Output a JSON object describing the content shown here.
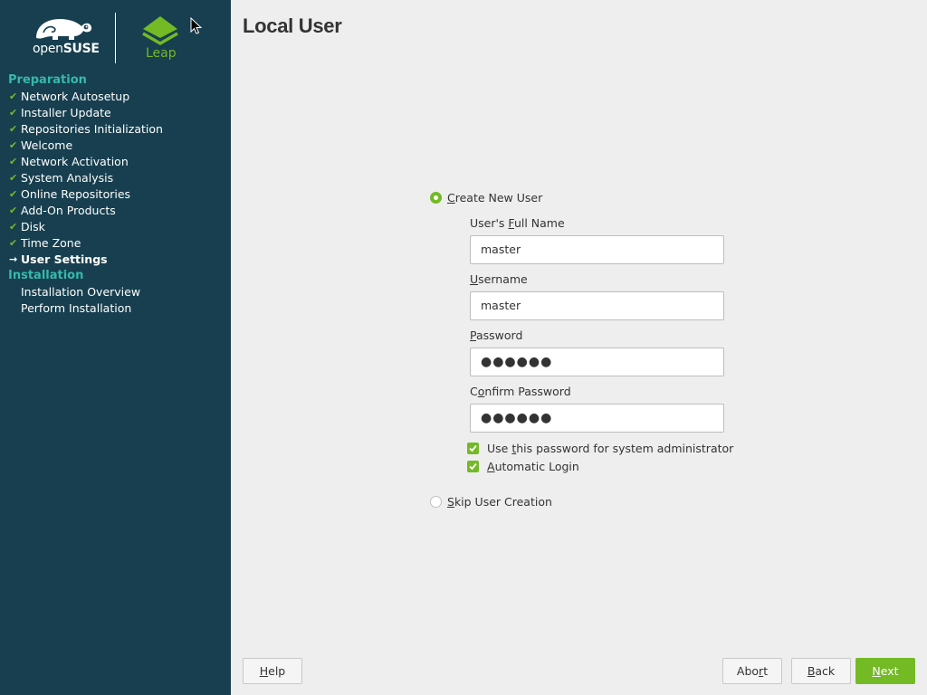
{
  "branding": {
    "opensuse_prefix": "open",
    "opensuse_suffix": "SUSE",
    "leap": "Leap"
  },
  "sidebar": {
    "sections": [
      {
        "title": "Preparation",
        "items": [
          {
            "label": "Network Autosetup",
            "status": "done"
          },
          {
            "label": "Installer Update",
            "status": "done"
          },
          {
            "label": "Repositories Initialization",
            "status": "done"
          },
          {
            "label": "Welcome",
            "status": "done"
          },
          {
            "label": "Network Activation",
            "status": "done"
          },
          {
            "label": "System Analysis",
            "status": "done"
          },
          {
            "label": "Online Repositories",
            "status": "done"
          },
          {
            "label": "Add-On Products",
            "status": "done"
          },
          {
            "label": "Disk",
            "status": "done"
          },
          {
            "label": "Time Zone",
            "status": "done"
          },
          {
            "label": "User Settings",
            "status": "current"
          }
        ]
      },
      {
        "title": "Installation",
        "items": [
          {
            "label": "Installation Overview",
            "status": "pending"
          },
          {
            "label": "Perform Installation",
            "status": "pending"
          }
        ]
      }
    ]
  },
  "main": {
    "title": "Local User",
    "create_user_label": "Create New User",
    "create_user_selected": true,
    "full_name_label": "User's Full Name",
    "full_name_value": "master",
    "username_label": "Username",
    "username_value": "master",
    "password_label": "Password",
    "password_value": "●●●●●●",
    "confirm_password_label": "Confirm Password",
    "confirm_password_value": "●●●●●●",
    "use_for_admin_label": "Use this password for system administrator",
    "use_for_admin_checked": true,
    "auto_login_label": "Automatic Login",
    "auto_login_checked": true,
    "skip_user_label": "Skip User Creation",
    "skip_user_selected": false
  },
  "buttons": {
    "help": "Help",
    "abort": "Abort",
    "back": "Back",
    "next": "Next"
  },
  "colors": {
    "sidebar_bg": "#173f4f",
    "section_teal": "#35b9ab",
    "accent_green": "#73ba25",
    "content_bg": "#eeeeee"
  }
}
